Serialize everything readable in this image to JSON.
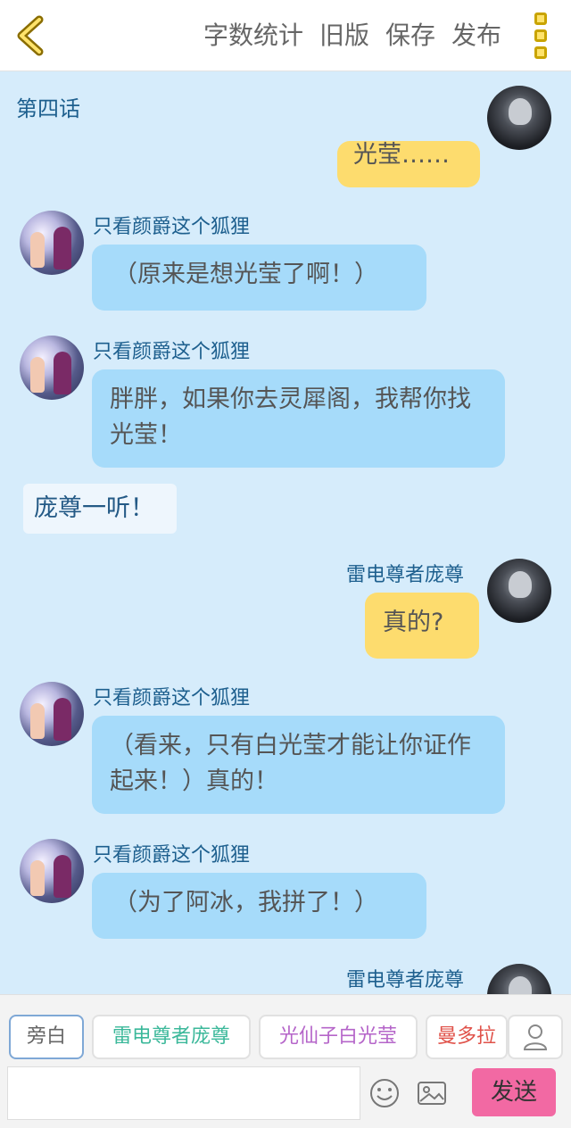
{
  "header": {
    "back_icon": "chevron-left-icon",
    "actions": [
      "字数统计",
      "旧版",
      "保存",
      "发布"
    ],
    "more_icon": "more-vertical-icon",
    "accent_color": "#c9a400"
  },
  "chat": {
    "chapter_title": "第四话",
    "messages": [
      {
        "speaker": "",
        "text": "光莹……",
        "side": "right",
        "style": "yellow"
      },
      {
        "speaker": "只看颜爵这个狐狸",
        "text": "（原来是想光莹了啊！）",
        "side": "left",
        "style": "blue"
      },
      {
        "speaker": "只看颜爵这个狐狸",
        "text": "胖胖，如果你去灵犀阁，我帮你找光莹！",
        "side": "left",
        "style": "blue"
      },
      {
        "speaker": "",
        "text": "庞尊一听！",
        "side": "narration",
        "style": "white"
      },
      {
        "speaker": "雷电尊者庞尊",
        "text": "真的?",
        "side": "right",
        "style": "yellow"
      },
      {
        "speaker": "只看颜爵这个狐狸",
        "text": "（看来，只有白光莹才能让你证作起来！）真的！",
        "side": "left",
        "style": "blue"
      },
      {
        "speaker": "只看颜爵这个狐狸",
        "text": "（为了阿冰，我拼了！）",
        "side": "left",
        "style": "blue"
      },
      {
        "speaker": "雷电尊者庞尊",
        "text": "",
        "side": "right",
        "style": "yellow"
      }
    ]
  },
  "composer": {
    "roles": [
      {
        "label": "旁白",
        "color": "#666666"
      },
      {
        "label": "雷电尊者庞尊",
        "color": "#3bb89a"
      },
      {
        "label": "光仙子白光莹",
        "color": "#b565c9"
      },
      {
        "label": "曼多拉",
        "color": "#e0524a"
      }
    ],
    "add_role_icon": "user-icon",
    "input_value": "",
    "emoji_icon": "smiley-icon",
    "image_icon": "image-icon",
    "send_label": "发送",
    "send_color": "#f269a3"
  }
}
